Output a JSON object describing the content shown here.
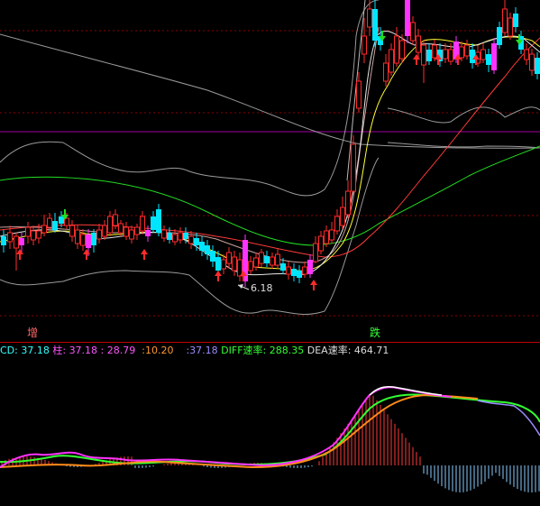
{
  "colors": {
    "background": "#000000",
    "grid": "#8b0000",
    "rise": "#ff2b2b",
    "fall": "#00e5ff",
    "highlight": "#ff33ff",
    "ma_white": "#d9d9d9",
    "ma_yellow": "#ffff33",
    "ma_green": "#22dd22",
    "ma_red": "#ff3a3a",
    "ma_gray": "#9a9a9a",
    "ma_pink": "#c8a0a0",
    "macd_pink": "#ff33ff",
    "macd_orange": "#ff8c1a",
    "macd_green": "#33ff33",
    "macd_purple": "#9a8cff",
    "macd_bar_pos": "#ff3a3a",
    "macd_bar_neg": "#88ccff",
    "indicator_cyan": "#33ffff",
    "indicator_magenta": "#ff55ff",
    "indicator_orange": "#ff9933",
    "indicator_green": "#33ff33",
    "indicator_white": "#dddddd",
    "signal_up": "#ff2b2b",
    "signal_down": "#22dd22"
  },
  "main_chart": {
    "low_price_label": "6.18",
    "signal_increase": "增",
    "signal_drop": "跌"
  },
  "indicator_bar": {
    "cd_label": "CD",
    "cd_value": "37.18",
    "zhu_label": "柱",
    "zhu_value": "37.18",
    "value_a": "28.79",
    "value_b": "10.20",
    "value_c": "37.18",
    "diff_label": "DIFF速率",
    "diff_value": "288.35",
    "dea_label": "DEA速率",
    "dea_value": "464.71"
  },
  "icons": {
    "up_arrow": "up-arrow-icon",
    "down_arrow": "down-arrow-icon"
  }
}
